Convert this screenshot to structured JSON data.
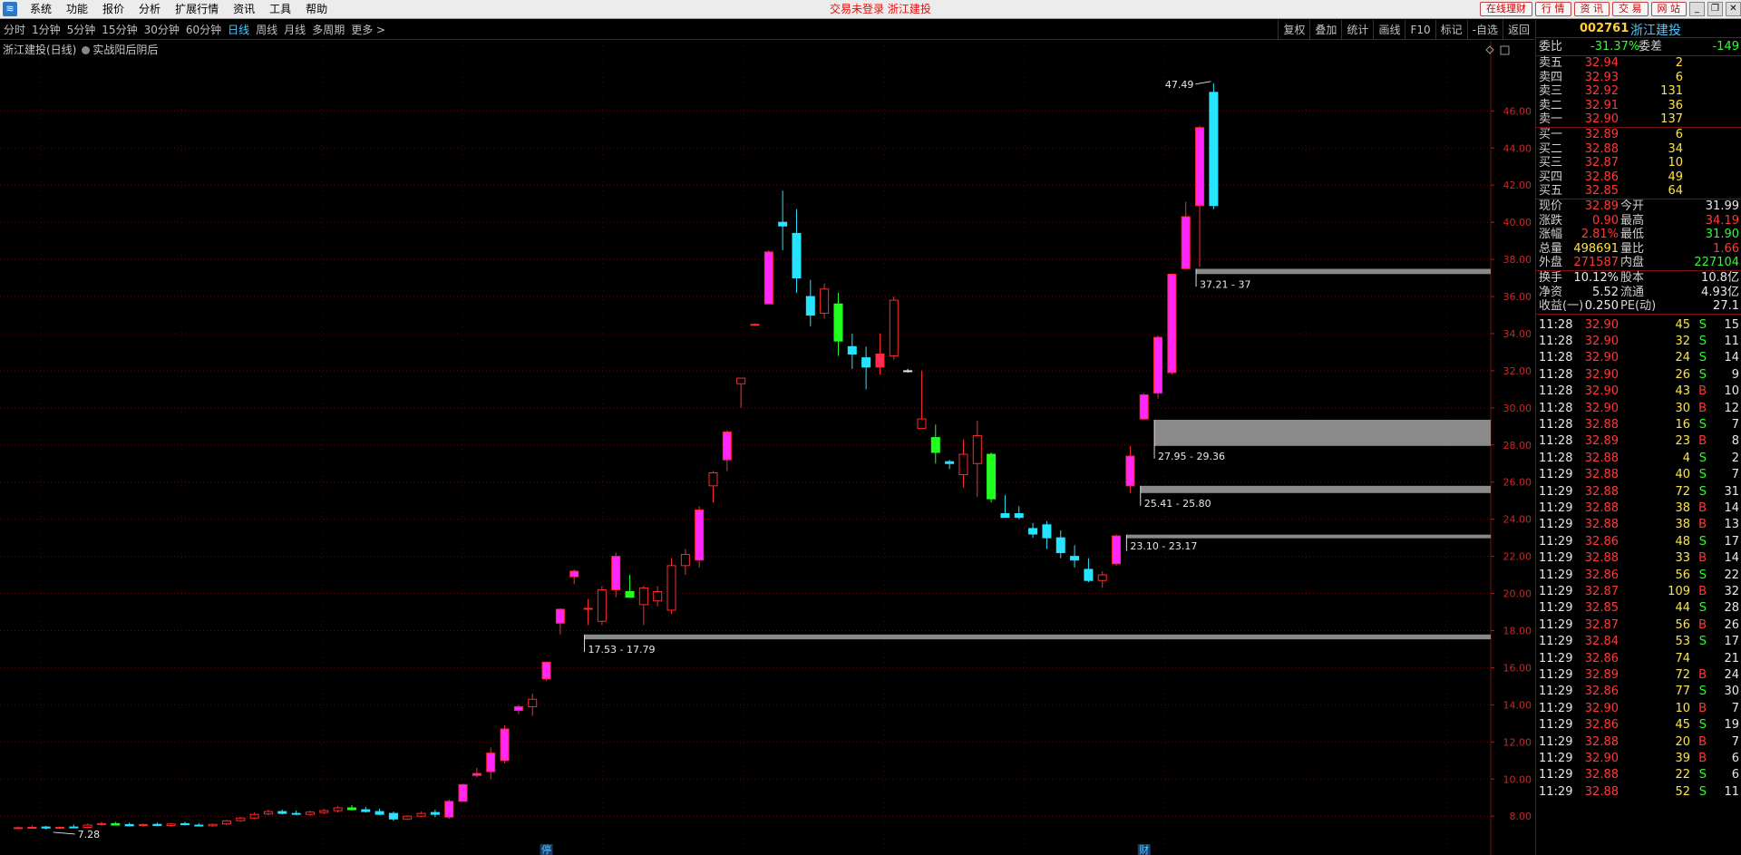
{
  "menu": {
    "items": [
      "系统",
      "功能",
      "报价",
      "分析",
      "扩展行情",
      "资讯",
      "工具",
      "帮助"
    ],
    "center_text": "交易未登录  浙江建投",
    "right_buttons": [
      "在线理财",
      "行  情",
      "资  讯",
      "交  易",
      "网  站"
    ]
  },
  "periods": {
    "items": [
      "分时",
      "1分钟",
      "5分钟",
      "15分钟",
      "30分钟",
      "60分钟",
      "日线",
      "周线",
      "月线",
      "多周期",
      "更多 >"
    ],
    "active": "日线",
    "tools": [
      "复权",
      "叠加",
      "统计",
      "画线",
      "F10",
      "标记",
      "-自选",
      "返回"
    ]
  },
  "chart": {
    "stock_label": "浙江建投(日线)",
    "indicator_label": "实战阳后阴后",
    "colors": {
      "up": "#ff2a2a",
      "up_fill": "#ff26ff",
      "down_cyan": "#26e4ff",
      "down_green": "#20ff20",
      "grid": "#5a0c0c",
      "axis_text": "#c82828"
    },
    "y_ticks": [
      8.0,
      10.0,
      12.0,
      14.0,
      16.0,
      18.0,
      20.0,
      22.0,
      24.0,
      26.0,
      28.0,
      30.0,
      32.0,
      34.0,
      36.0,
      38.0,
      40.0,
      42.0,
      44.0,
      46.0
    ],
    "y_tick_labels": [
      "8.00",
      "10.00",
      "12.00",
      "14.00",
      "16.00",
      "18.00",
      "20.00",
      "22.00",
      "24.00",
      "26.00",
      "28.00",
      "30.00",
      "32.00",
      "34.00",
      "36.00",
      "38.00",
      "40.00",
      "42.00",
      "44.00",
      "46.00"
    ],
    "ylim": [
      6.3,
      48.8
    ],
    "high_marker": "47.49",
    "low_marker": "7.28",
    "bottom_markers": [
      {
        "text": "停",
        "index": 38
      },
      {
        "text": "财",
        "index": 81
      }
    ],
    "zones": [
      {
        "low": 17.53,
        "high": 17.79,
        "label": "17.53 - 17.79",
        "start_index": 41
      },
      {
        "low": 23.1,
        "high": 23.17,
        "label": "23.10 - 23.17",
        "start_index": 80
      },
      {
        "low": 25.41,
        "high": 25.8,
        "label": "25.41 - 25.80",
        "start_index": 81
      },
      {
        "low": 27.95,
        "high": 29.36,
        "label": "27.95 - 29.36",
        "start_index": 82
      },
      {
        "low": 37.21,
        "high": 37.49,
        "label": "37.21 - 37",
        "start_index": 85
      }
    ]
  },
  "chart_data": {
    "type": "candlestick",
    "candles": [
      {
        "o": 7.35,
        "h": 7.45,
        "l": 7.3,
        "c": 7.38,
        "k": "up"
      },
      {
        "o": 7.38,
        "h": 7.5,
        "l": 7.32,
        "c": 7.4,
        "k": "up"
      },
      {
        "o": 7.42,
        "h": 7.48,
        "l": 7.28,
        "c": 7.36,
        "k": "cyan"
      },
      {
        "o": 7.36,
        "h": 7.45,
        "l": 7.3,
        "c": 7.4,
        "k": "up"
      },
      {
        "o": 7.42,
        "h": 7.55,
        "l": 7.35,
        "c": 7.38,
        "k": "cyan"
      },
      {
        "o": 7.4,
        "h": 7.6,
        "l": 7.35,
        "c": 7.52,
        "k": "up"
      },
      {
        "o": 7.55,
        "h": 7.7,
        "l": 7.48,
        "c": 7.6,
        "k": "up"
      },
      {
        "o": 7.6,
        "h": 7.7,
        "l": 7.5,
        "c": 7.52,
        "k": "green"
      },
      {
        "o": 7.55,
        "h": 7.65,
        "l": 7.45,
        "c": 7.48,
        "k": "cyan"
      },
      {
        "o": 7.5,
        "h": 7.6,
        "l": 7.42,
        "c": 7.55,
        "k": "up"
      },
      {
        "o": 7.56,
        "h": 7.66,
        "l": 7.46,
        "c": 7.5,
        "k": "cyan"
      },
      {
        "o": 7.5,
        "h": 7.62,
        "l": 7.42,
        "c": 7.58,
        "k": "up"
      },
      {
        "o": 7.6,
        "h": 7.7,
        "l": 7.5,
        "c": 7.54,
        "k": "cyan"
      },
      {
        "o": 7.52,
        "h": 7.62,
        "l": 7.45,
        "c": 7.48,
        "k": "cyan"
      },
      {
        "o": 7.48,
        "h": 7.6,
        "l": 7.42,
        "c": 7.56,
        "k": "up"
      },
      {
        "o": 7.58,
        "h": 7.8,
        "l": 7.52,
        "c": 7.75,
        "k": "up"
      },
      {
        "o": 7.76,
        "h": 7.95,
        "l": 7.7,
        "c": 7.9,
        "k": "up"
      },
      {
        "o": 7.9,
        "h": 8.2,
        "l": 7.85,
        "c": 8.1,
        "k": "up"
      },
      {
        "o": 8.12,
        "h": 8.35,
        "l": 8.05,
        "c": 8.25,
        "k": "up"
      },
      {
        "o": 8.25,
        "h": 8.35,
        "l": 8.1,
        "c": 8.15,
        "k": "cyan"
      },
      {
        "o": 8.15,
        "h": 8.3,
        "l": 8.05,
        "c": 8.1,
        "k": "cyan"
      },
      {
        "o": 8.1,
        "h": 8.3,
        "l": 8.02,
        "c": 8.22,
        "k": "up"
      },
      {
        "o": 8.2,
        "h": 8.4,
        "l": 8.1,
        "c": 8.3,
        "k": "up"
      },
      {
        "o": 8.3,
        "h": 8.55,
        "l": 8.2,
        "c": 8.45,
        "k": "up"
      },
      {
        "o": 8.45,
        "h": 8.6,
        "l": 8.3,
        "c": 8.35,
        "k": "green"
      },
      {
        "o": 8.35,
        "h": 8.5,
        "l": 8.2,
        "c": 8.25,
        "k": "cyan"
      },
      {
        "o": 8.25,
        "h": 8.4,
        "l": 8.05,
        "c": 8.1,
        "k": "cyan"
      },
      {
        "o": 8.15,
        "h": 8.25,
        "l": 7.75,
        "c": 7.85,
        "k": "cyan"
      },
      {
        "o": 7.85,
        "h": 8.05,
        "l": 7.8,
        "c": 8.0,
        "k": "up"
      },
      {
        "o": 8.0,
        "h": 8.25,
        "l": 7.95,
        "c": 8.15,
        "k": "up"
      },
      {
        "o": 8.1,
        "h": 8.35,
        "l": 7.95,
        "c": 8.2,
        "k": "cyan"
      },
      {
        "o": 7.95,
        "h": 8.9,
        "l": 7.85,
        "c": 8.8,
        "k": "fill"
      },
      {
        "o": 8.8,
        "h": 9.75,
        "l": 8.8,
        "c": 9.7,
        "k": "fill"
      },
      {
        "o": 10.2,
        "h": 10.6,
        "l": 10.1,
        "c": 10.3,
        "k": "fill"
      },
      {
        "o": 10.4,
        "h": 11.7,
        "l": 10.0,
        "c": 11.4,
        "k": "fill"
      },
      {
        "o": 11.0,
        "h": 12.9,
        "l": 10.85,
        "c": 12.7,
        "k": "fill"
      },
      {
        "o": 13.7,
        "h": 14.0,
        "l": 13.5,
        "c": 13.9,
        "k": "fill"
      },
      {
        "o": 13.9,
        "h": 14.6,
        "l": 13.4,
        "c": 14.3,
        "k": "up"
      },
      {
        "o": 15.4,
        "h": 16.2,
        "l": 15.3,
        "c": 16.3,
        "k": "fill"
      },
      {
        "o": 18.4,
        "h": 19.2,
        "l": 17.79,
        "c": 19.15,
        "k": "fill"
      },
      {
        "o": 20.9,
        "h": 21.3,
        "l": 20.5,
        "c": 21.2,
        "k": "fill"
      },
      {
        "o": 19.2,
        "h": 19.7,
        "l": 18.3,
        "c": 19.2,
        "k": "up"
      },
      {
        "o": 18.5,
        "h": 20.4,
        "l": 18.3,
        "c": 20.2,
        "k": "up"
      },
      {
        "o": 20.2,
        "h": 22.2,
        "l": 19.8,
        "c": 22.0,
        "k": "fill"
      },
      {
        "o": 20.1,
        "h": 21.0,
        "l": 19.8,
        "c": 19.8,
        "k": "green"
      },
      {
        "o": 19.4,
        "h": 20.4,
        "l": 18.3,
        "c": 20.3,
        "k": "up"
      },
      {
        "o": 19.6,
        "h": 20.4,
        "l": 19.3,
        "c": 20.1,
        "k": "up"
      },
      {
        "o": 19.1,
        "h": 21.9,
        "l": 18.9,
        "c": 21.5,
        "k": "up"
      },
      {
        "o": 21.5,
        "h": 22.4,
        "l": 21.0,
        "c": 22.1,
        "k": "up"
      },
      {
        "o": 21.8,
        "h": 24.7,
        "l": 21.4,
        "c": 24.5,
        "k": "fill"
      },
      {
        "o": 25.8,
        "h": 26.6,
        "l": 24.9,
        "c": 26.5,
        "k": "up"
      },
      {
        "o": 27.2,
        "h": 28.8,
        "l": 26.6,
        "c": 28.7,
        "k": "fill"
      },
      {
        "o": 31.3,
        "h": 31.6,
        "l": 30.0,
        "c": 31.6,
        "k": "up"
      },
      {
        "o": 34.5,
        "h": 34.55,
        "l": 34.45,
        "c": 34.5,
        "k": "up"
      },
      {
        "o": 35.6,
        "h": 38.5,
        "l": 35.6,
        "c": 38.4,
        "k": "fill"
      },
      {
        "o": 40.0,
        "h": 41.7,
        "l": 38.5,
        "c": 39.8,
        "k": "cyan"
      },
      {
        "o": 39.4,
        "h": 40.7,
        "l": 36.2,
        "c": 37.0,
        "k": "cyan"
      },
      {
        "o": 36.0,
        "h": 36.9,
        "l": 34.4,
        "c": 35.0,
        "k": "cyan"
      },
      {
        "o": 35.1,
        "h": 36.7,
        "l": 34.8,
        "c": 36.4,
        "k": "up"
      },
      {
        "o": 35.6,
        "h": 36.2,
        "l": 32.8,
        "c": 33.6,
        "k": "green"
      },
      {
        "o": 33.3,
        "h": 34.0,
        "l": 32.1,
        "c": 32.9,
        "k": "cyan"
      },
      {
        "o": 32.7,
        "h": 33.3,
        "l": 31.0,
        "c": 32.2,
        "k": "cyan"
      },
      {
        "o": 32.2,
        "h": 34.0,
        "l": 31.8,
        "c": 32.9,
        "k": "fill_red"
      },
      {
        "o": 32.8,
        "h": 36.0,
        "l": 32.6,
        "c": 35.8,
        "k": "up"
      },
      {
        "o": 32.0,
        "h": 32.1,
        "l": 31.9,
        "c": 32.0,
        "k": "flat"
      },
      {
        "o": 29.4,
        "h": 32.0,
        "l": 28.9,
        "c": 28.9,
        "k": "up"
      },
      {
        "o": 28.4,
        "h": 29.1,
        "l": 27.0,
        "c": 27.6,
        "k": "green"
      },
      {
        "o": 27.1,
        "h": 27.2,
        "l": 26.7,
        "c": 27.0,
        "k": "cyan"
      },
      {
        "o": 26.4,
        "h": 28.3,
        "l": 25.7,
        "c": 27.5,
        "k": "up"
      },
      {
        "o": 28.5,
        "h": 29.3,
        "l": 25.2,
        "c": 27.0,
        "k": "up"
      },
      {
        "o": 27.5,
        "h": 27.6,
        "l": 24.9,
        "c": 25.1,
        "k": "green"
      },
      {
        "o": 24.3,
        "h": 25.3,
        "l": 24.1,
        "c": 24.1,
        "k": "cyan"
      },
      {
        "o": 24.3,
        "h": 24.7,
        "l": 24.0,
        "c": 24.1,
        "k": "cyan"
      },
      {
        "o": 23.5,
        "h": 23.8,
        "l": 23.0,
        "c": 23.2,
        "k": "cyan"
      },
      {
        "o": 23.7,
        "h": 23.9,
        "l": 22.4,
        "c": 23.0,
        "k": "cyan"
      },
      {
        "o": 23.0,
        "h": 23.4,
        "l": 21.9,
        "c": 22.2,
        "k": "cyan"
      },
      {
        "o": 22.0,
        "h": 22.6,
        "l": 21.4,
        "c": 21.8,
        "k": "cyan"
      },
      {
        "o": 21.3,
        "h": 21.9,
        "l": 20.6,
        "c": 20.7,
        "k": "cyan"
      },
      {
        "o": 20.7,
        "h": 21.2,
        "l": 20.3,
        "c": 21.0,
        "k": "up"
      },
      {
        "o": 21.6,
        "h": 23.17,
        "l": 21.5,
        "c": 23.1,
        "k": "fill"
      },
      {
        "o": 25.8,
        "h": 27.95,
        "l": 25.41,
        "c": 27.4,
        "k": "fill"
      },
      {
        "o": 29.4,
        "h": 30.8,
        "l": 29.36,
        "c": 30.7,
        "k": "fill"
      },
      {
        "o": 30.8,
        "h": 33.9,
        "l": 30.5,
        "c": 33.8,
        "k": "fill"
      },
      {
        "o": 31.9,
        "h": 37.21,
        "l": 31.8,
        "c": 37.2,
        "k": "fill"
      },
      {
        "o": 37.5,
        "h": 41.1,
        "l": 37.49,
        "c": 40.3,
        "k": "fill"
      },
      {
        "o": 40.9,
        "h": 45.2,
        "l": 37.6,
        "c": 45.1,
        "k": "fill"
      },
      {
        "o": 47.0,
        "h": 47.49,
        "l": 40.7,
        "c": 40.9,
        "k": "cyan"
      }
    ]
  },
  "panel": {
    "code": "002761",
    "name": "浙江建投",
    "weibi_label": "委比",
    "weibi": "-31.37%",
    "weicha_label": "委差",
    "weicha": "-149",
    "sell": [
      {
        "label": "卖五",
        "price": "32.94",
        "vol": "2"
      },
      {
        "label": "卖四",
        "price": "32.93",
        "vol": "6"
      },
      {
        "label": "卖三",
        "price": "32.92",
        "vol": "131"
      },
      {
        "label": "卖二",
        "price": "32.91",
        "vol": "36"
      },
      {
        "label": "卖一",
        "price": "32.90",
        "vol": "137"
      }
    ],
    "buy": [
      {
        "label": "买一",
        "price": "32.89",
        "vol": "6"
      },
      {
        "label": "买二",
        "price": "32.88",
        "vol": "34"
      },
      {
        "label": "买三",
        "price": "32.87",
        "vol": "10"
      },
      {
        "label": "买四",
        "price": "32.86",
        "vol": "49"
      },
      {
        "label": "买五",
        "price": "32.85",
        "vol": "64"
      }
    ],
    "quote": [
      {
        "l1": "现价",
        "v1": "32.89",
        "c1": "red",
        "l2": "今开",
        "v2": "31.99",
        "c2": "white"
      },
      {
        "l1": "涨跌",
        "v1": "0.90",
        "c1": "red",
        "l2": "最高",
        "v2": "34.19",
        "c2": "red"
      },
      {
        "l1": "涨幅",
        "v1": "2.81%",
        "c1": "red",
        "l2": "最低",
        "v2": "31.90",
        "c2": "green"
      },
      {
        "l1": "总量",
        "v1": "498691",
        "c1": "yellow",
        "l2": "量比",
        "v2": "1.66",
        "c2": "red"
      },
      {
        "l1": "外盘",
        "v1": "271587",
        "c1": "red",
        "l2": "内盘",
        "v2": "227104",
        "c2": "green"
      }
    ],
    "fundamentals": [
      {
        "l1": "换手",
        "v1": "10.12%",
        "l2": "股本",
        "v2": "10.8亿"
      },
      {
        "l1": "净资",
        "v1": "5.52",
        "l2": "流通",
        "v2": "4.93亿"
      },
      {
        "l1": "收益(一)",
        "v1": "0.250",
        "l2": "PE(动)",
        "v2": "27.1"
      }
    ],
    "ticks": [
      {
        "t": "11:28",
        "p": "32.90",
        "v": "45",
        "s": "S",
        "n": "15"
      },
      {
        "t": "11:28",
        "p": "32.90",
        "v": "32",
        "s": "S",
        "n": "11"
      },
      {
        "t": "11:28",
        "p": "32.90",
        "v": "24",
        "s": "S",
        "n": "14"
      },
      {
        "t": "11:28",
        "p": "32.90",
        "v": "26",
        "s": "S",
        "n": "9"
      },
      {
        "t": "11:28",
        "p": "32.90",
        "v": "43",
        "s": "B",
        "n": "10"
      },
      {
        "t": "11:28",
        "p": "32.90",
        "v": "30",
        "s": "B",
        "n": "12"
      },
      {
        "t": "11:28",
        "p": "32.88",
        "v": "16",
        "s": "S",
        "n": "7"
      },
      {
        "t": "11:28",
        "p": "32.89",
        "v": "23",
        "s": "B",
        "n": "8"
      },
      {
        "t": "11:28",
        "p": "32.88",
        "v": "4",
        "s": "S",
        "n": "2"
      },
      {
        "t": "11:29",
        "p": "32.88",
        "v": "40",
        "s": "S",
        "n": "7"
      },
      {
        "t": "11:29",
        "p": "32.88",
        "v": "72",
        "s": "S",
        "n": "31"
      },
      {
        "t": "11:29",
        "p": "32.88",
        "v": "38",
        "s": "B",
        "n": "14"
      },
      {
        "t": "11:29",
        "p": "32.88",
        "v": "38",
        "s": "B",
        "n": "13"
      },
      {
        "t": "11:29",
        "p": "32.86",
        "v": "48",
        "s": "S",
        "n": "17"
      },
      {
        "t": "11:29",
        "p": "32.88",
        "v": "33",
        "s": "B",
        "n": "14"
      },
      {
        "t": "11:29",
        "p": "32.86",
        "v": "56",
        "s": "S",
        "n": "22"
      },
      {
        "t": "11:29",
        "p": "32.87",
        "v": "109",
        "s": "B",
        "n": "32"
      },
      {
        "t": "11:29",
        "p": "32.85",
        "v": "44",
        "s": "S",
        "n": "28"
      },
      {
        "t": "11:29",
        "p": "32.87",
        "v": "56",
        "s": "B",
        "n": "26"
      },
      {
        "t": "11:29",
        "p": "32.84",
        "v": "53",
        "s": "S",
        "n": "17"
      },
      {
        "t": "11:29",
        "p": "32.86",
        "v": "74",
        "s": "",
        "n": "21"
      },
      {
        "t": "11:29",
        "p": "32.89",
        "v": "72",
        "s": "B",
        "n": "24"
      },
      {
        "t": "11:29",
        "p": "32.86",
        "v": "77",
        "s": "S",
        "n": "30"
      },
      {
        "t": "11:29",
        "p": "32.90",
        "v": "10",
        "s": "B",
        "n": "7"
      },
      {
        "t": "11:29",
        "p": "32.86",
        "v": "45",
        "s": "S",
        "n": "19"
      },
      {
        "t": "11:29",
        "p": "32.88",
        "v": "20",
        "s": "B",
        "n": "7"
      },
      {
        "t": "11:29",
        "p": "32.90",
        "v": "39",
        "s": "B",
        "n": "6"
      },
      {
        "t": "11:29",
        "p": "32.88",
        "v": "22",
        "s": "S",
        "n": "6"
      },
      {
        "t": "11:29",
        "p": "32.88",
        "v": "52",
        "s": "S",
        "n": "11"
      }
    ]
  }
}
